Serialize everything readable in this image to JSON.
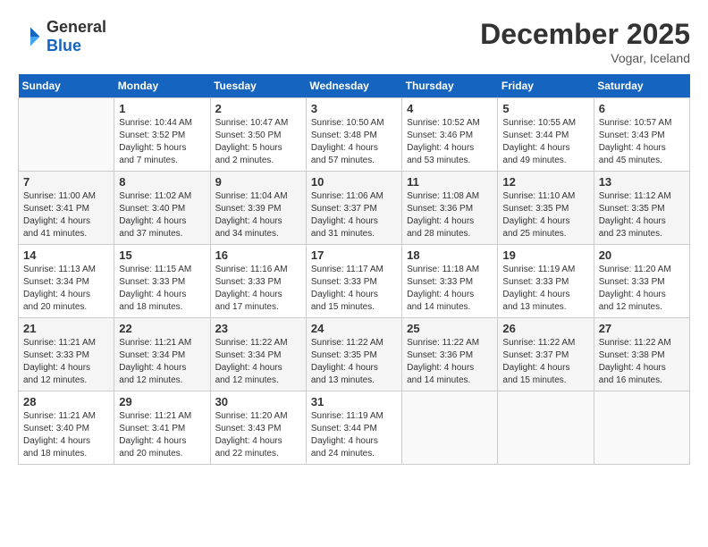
{
  "header": {
    "logo_general": "General",
    "logo_blue": "Blue",
    "month_title": "December 2025",
    "location": "Vogar, Iceland"
  },
  "days_of_week": [
    "Sunday",
    "Monday",
    "Tuesday",
    "Wednesday",
    "Thursday",
    "Friday",
    "Saturday"
  ],
  "weeks": [
    [
      {
        "day": "",
        "info": ""
      },
      {
        "day": "1",
        "info": "Sunrise: 10:44 AM\nSunset: 3:52 PM\nDaylight: 5 hours\nand 7 minutes."
      },
      {
        "day": "2",
        "info": "Sunrise: 10:47 AM\nSunset: 3:50 PM\nDaylight: 5 hours\nand 2 minutes."
      },
      {
        "day": "3",
        "info": "Sunrise: 10:50 AM\nSunset: 3:48 PM\nDaylight: 4 hours\nand 57 minutes."
      },
      {
        "day": "4",
        "info": "Sunrise: 10:52 AM\nSunset: 3:46 PM\nDaylight: 4 hours\nand 53 minutes."
      },
      {
        "day": "5",
        "info": "Sunrise: 10:55 AM\nSunset: 3:44 PM\nDaylight: 4 hours\nand 49 minutes."
      },
      {
        "day": "6",
        "info": "Sunrise: 10:57 AM\nSunset: 3:43 PM\nDaylight: 4 hours\nand 45 minutes."
      }
    ],
    [
      {
        "day": "7",
        "info": "Sunrise: 11:00 AM\nSunset: 3:41 PM\nDaylight: 4 hours\nand 41 minutes."
      },
      {
        "day": "8",
        "info": "Sunrise: 11:02 AM\nSunset: 3:40 PM\nDaylight: 4 hours\nand 37 minutes."
      },
      {
        "day": "9",
        "info": "Sunrise: 11:04 AM\nSunset: 3:39 PM\nDaylight: 4 hours\nand 34 minutes."
      },
      {
        "day": "10",
        "info": "Sunrise: 11:06 AM\nSunset: 3:37 PM\nDaylight: 4 hours\nand 31 minutes."
      },
      {
        "day": "11",
        "info": "Sunrise: 11:08 AM\nSunset: 3:36 PM\nDaylight: 4 hours\nand 28 minutes."
      },
      {
        "day": "12",
        "info": "Sunrise: 11:10 AM\nSunset: 3:35 PM\nDaylight: 4 hours\nand 25 minutes."
      },
      {
        "day": "13",
        "info": "Sunrise: 11:12 AM\nSunset: 3:35 PM\nDaylight: 4 hours\nand 23 minutes."
      }
    ],
    [
      {
        "day": "14",
        "info": "Sunrise: 11:13 AM\nSunset: 3:34 PM\nDaylight: 4 hours\nand 20 minutes."
      },
      {
        "day": "15",
        "info": "Sunrise: 11:15 AM\nSunset: 3:33 PM\nDaylight: 4 hours\nand 18 minutes."
      },
      {
        "day": "16",
        "info": "Sunrise: 11:16 AM\nSunset: 3:33 PM\nDaylight: 4 hours\nand 17 minutes."
      },
      {
        "day": "17",
        "info": "Sunrise: 11:17 AM\nSunset: 3:33 PM\nDaylight: 4 hours\nand 15 minutes."
      },
      {
        "day": "18",
        "info": "Sunrise: 11:18 AM\nSunset: 3:33 PM\nDaylight: 4 hours\nand 14 minutes."
      },
      {
        "day": "19",
        "info": "Sunrise: 11:19 AM\nSunset: 3:33 PM\nDaylight: 4 hours\nand 13 minutes."
      },
      {
        "day": "20",
        "info": "Sunrise: 11:20 AM\nSunset: 3:33 PM\nDaylight: 4 hours\nand 12 minutes."
      }
    ],
    [
      {
        "day": "21",
        "info": "Sunrise: 11:21 AM\nSunset: 3:33 PM\nDaylight: 4 hours\nand 12 minutes."
      },
      {
        "day": "22",
        "info": "Sunrise: 11:21 AM\nSunset: 3:34 PM\nDaylight: 4 hours\nand 12 minutes."
      },
      {
        "day": "23",
        "info": "Sunrise: 11:22 AM\nSunset: 3:34 PM\nDaylight: 4 hours\nand 12 minutes."
      },
      {
        "day": "24",
        "info": "Sunrise: 11:22 AM\nSunset: 3:35 PM\nDaylight: 4 hours\nand 13 minutes."
      },
      {
        "day": "25",
        "info": "Sunrise: 11:22 AM\nSunset: 3:36 PM\nDaylight: 4 hours\nand 14 minutes."
      },
      {
        "day": "26",
        "info": "Sunrise: 11:22 AM\nSunset: 3:37 PM\nDaylight: 4 hours\nand 15 minutes."
      },
      {
        "day": "27",
        "info": "Sunrise: 11:22 AM\nSunset: 3:38 PM\nDaylight: 4 hours\nand 16 minutes."
      }
    ],
    [
      {
        "day": "28",
        "info": "Sunrise: 11:21 AM\nSunset: 3:40 PM\nDaylight: 4 hours\nand 18 minutes."
      },
      {
        "day": "29",
        "info": "Sunrise: 11:21 AM\nSunset: 3:41 PM\nDaylight: 4 hours\nand 20 minutes."
      },
      {
        "day": "30",
        "info": "Sunrise: 11:20 AM\nSunset: 3:43 PM\nDaylight: 4 hours\nand 22 minutes."
      },
      {
        "day": "31",
        "info": "Sunrise: 11:19 AM\nSunset: 3:44 PM\nDaylight: 4 hours\nand 24 minutes."
      },
      {
        "day": "",
        "info": ""
      },
      {
        "day": "",
        "info": ""
      },
      {
        "day": "",
        "info": ""
      }
    ]
  ]
}
